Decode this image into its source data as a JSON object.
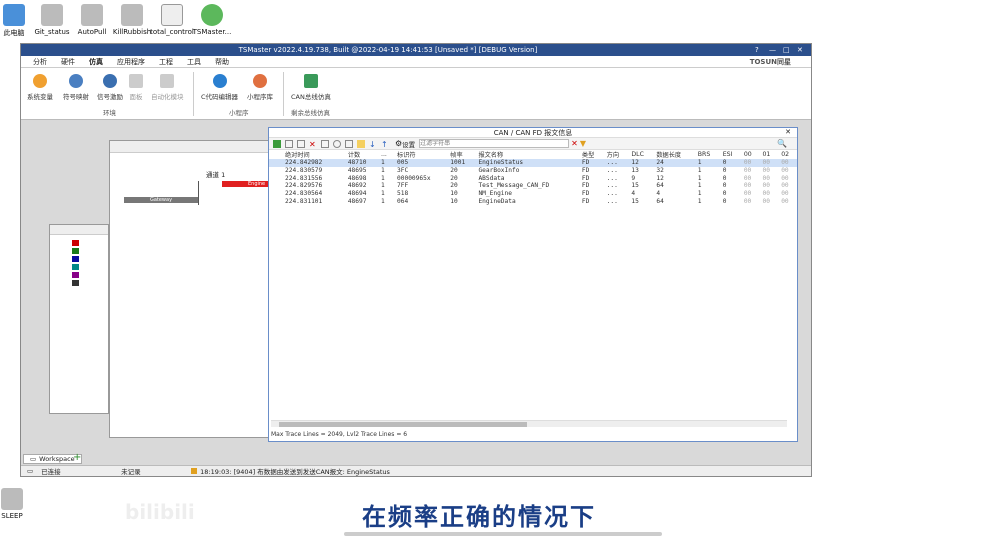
{
  "desktop": {
    "icons": [
      "此电脑",
      "Git_status",
      "AutoPull",
      "KillRubbish",
      "total_control",
      "TSMaster..."
    ],
    "bottom_icon": "SLEEP"
  },
  "app": {
    "title": "TSMaster v2022.4.19.738, Built @2022-04-19 14:41:53 [Unsaved *] [DEBUG Version]",
    "brand": "TOSUN同星",
    "menu": [
      "分析",
      "硬件",
      "仿真",
      "应用程序",
      "工程",
      "工具",
      "帮助"
    ],
    "ribbon": {
      "buttons": [
        "系统变量",
        "符号映射",
        "信号激励",
        "面板",
        "自动化模块",
        "C代码编辑器",
        "小程序库",
        "CAN总线仿真"
      ],
      "groups": [
        "环境",
        "小程序",
        "剩余总线仿真"
      ]
    }
  },
  "dialog": {
    "title": "CAN / CAN FD 报文信息",
    "settings": "设置",
    "filter_placeholder": "过滤字符串",
    "columns": [
      "绝对时间",
      "计数",
      "...",
      "标识符",
      "帧率",
      "报文名称",
      "类型",
      "方向",
      "DLC",
      "数据长度",
      "BRS",
      "ESI",
      "00",
      "01",
      "02"
    ],
    "rows": [
      [
        "224.842982",
        "48710",
        "1",
        "005",
        "1001",
        "EngineStatus",
        "FD",
        "...",
        "12",
        "24",
        "1",
        "0",
        "00",
        "00",
        "00"
      ],
      [
        "224.830579",
        "48695",
        "1",
        "3FC",
        "20",
        "GearBoxInfo",
        "FD",
        "...",
        "13",
        "32",
        "1",
        "0",
        "00",
        "00",
        "00"
      ],
      [
        "224.831556",
        "48698",
        "1",
        "00000965x",
        "20",
        "ABSdata",
        "FD",
        "...",
        "9",
        "12",
        "1",
        "0",
        "00",
        "00",
        "00"
      ],
      [
        "224.829576",
        "48692",
        "1",
        "7FF",
        "20",
        "Test_Message_CAN_FD",
        "FD",
        "...",
        "15",
        "64",
        "1",
        "0",
        "00",
        "00",
        "00"
      ],
      [
        "224.830564",
        "48694",
        "1",
        "518",
        "10",
        "NM_Engine",
        "FD",
        "...",
        "4",
        "4",
        "1",
        "0",
        "00",
        "00",
        "00"
      ],
      [
        "224.831101",
        "48697",
        "1",
        "064",
        "10",
        "EngineData",
        "FD",
        "...",
        "15",
        "64",
        "1",
        "0",
        "00",
        "00",
        "00"
      ]
    ],
    "footer": "Max Trace Lines = 2049, Lvl2 Trace Lines = 6"
  },
  "bg": {
    "channel": "通道 1",
    "engine": "Engine",
    "gateway": "Gateway"
  },
  "tabs": {
    "workspace": "Workspace"
  },
  "status": {
    "conn": "已连接",
    "record": "未记录",
    "log": "18:19:03: [9404] 布数据由发送到发送CAN报文: EngineStatus"
  },
  "caption": "在频率正确的情况下"
}
